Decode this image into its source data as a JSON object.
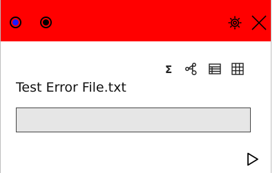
{
  "window": {
    "title_bar_color": "#ff0000",
    "status_dots": [
      {
        "name": "blue-dot",
        "color": "#1a1aff"
      },
      {
        "name": "black-dot",
        "color": "#000000"
      }
    ],
    "buttons": [
      {
        "name": "settings",
        "icon": "gear-icon"
      },
      {
        "name": "close",
        "icon": "close-icon"
      }
    ]
  },
  "toolbar": [
    {
      "name": "sum",
      "icon": "sigma-icon"
    },
    {
      "name": "graph",
      "icon": "node-graph-icon"
    },
    {
      "name": "list",
      "icon": "list-view-icon"
    },
    {
      "name": "grid",
      "icon": "grid-view-icon"
    }
  ],
  "file": {
    "name": "Test Error File.txt"
  },
  "progress": {
    "value": 0
  },
  "actions": {
    "run_icon": "play-icon"
  }
}
